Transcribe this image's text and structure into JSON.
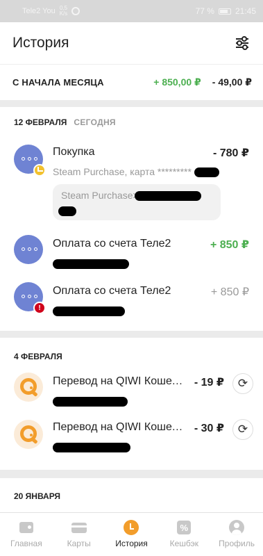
{
  "status_bar": {
    "carrier": "Tele2 You",
    "net_speed_value": "0,5",
    "net_speed_unit": "K/s",
    "battery": "77 %",
    "time": "21:45"
  },
  "header": {
    "title": "История",
    "filter_icon": "sliders-icon"
  },
  "summary": {
    "label": "С НАЧАЛА МЕСЯЦА",
    "income": "+ 850,00 ₽",
    "expense": "- 49,00 ₽"
  },
  "groups": [
    {
      "date": "12 ФЕВРАЛЯ",
      "tag": "СЕГОДНЯ",
      "items": [
        {
          "title": "Покупка",
          "amount": "- 780 ₽",
          "subtitle": "Steam Purchase, карта *********",
          "comment": "Steam Purchase>"
        },
        {
          "title": "Оплата со счета Теле2",
          "amount": "+ 850 ₽"
        },
        {
          "title": "Оплата со счета Теле2",
          "amount": "+ 850 ₽",
          "badge": "!"
        }
      ]
    },
    {
      "date": "4 ФЕВРАЛЯ",
      "items": [
        {
          "title": "Перевод на QIWI Кошелек",
          "amount": "- 19 ₽"
        },
        {
          "title": "Перевод на QIWI Кошелек",
          "amount": "- 30 ₽"
        }
      ]
    },
    {
      "date": "20 ЯНВАРЯ"
    }
  ],
  "tabs": [
    {
      "label": "Главная",
      "icon": "wallet-icon"
    },
    {
      "label": "Карты",
      "icon": "card-icon"
    },
    {
      "label": "История",
      "icon": "history-icon",
      "active": true
    },
    {
      "label": "Кешбэк",
      "icon": "cashback-icon"
    },
    {
      "label": "Профиль",
      "icon": "profile-icon"
    }
  ],
  "colors": {
    "accent": "#f29d2b",
    "income": "#4caf50",
    "avatar": "#6f83d3",
    "error": "#d0021b",
    "pending": "#f2c12e"
  }
}
